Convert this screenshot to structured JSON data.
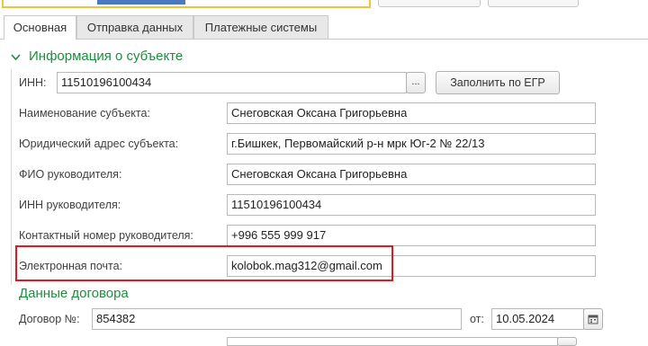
{
  "tabs": [
    "Основная",
    "Отправка данных",
    "Платежные системы"
  ],
  "section_subject": {
    "title": "Информация о субъекте",
    "inn_label": "ИНН:",
    "inn_value": "11510196100434",
    "ellipsis": "...",
    "fill_button": "Заполнить по ЕГР"
  },
  "fields": [
    {
      "label": "Наименование субъекта:",
      "value": "Снеговская Оксана Григорьевна"
    },
    {
      "label": "Юридический адрес субъекта:",
      "value": "г.Бишкек, Первомайский р-н мрк Юг-2 № 22/13"
    },
    {
      "label": "ФИО руководителя:",
      "value": "Снеговская Оксана Григорьевна"
    },
    {
      "label": "ИНН руководителя:",
      "value": "11510196100434"
    },
    {
      "label": "Контактный номер руководителя:",
      "value": "+996 555 999 917"
    },
    {
      "label": "Электронная почта:",
      "value": "kolobok.mag312@gmail.com"
    }
  ],
  "section_contract": {
    "title": "Данные договора",
    "number_label": "Договор №:",
    "number_value": "854382",
    "from_label": "от:",
    "date_value": "10.05.2024"
  },
  "colors": {
    "section_green": "#1a8f3c",
    "highlight_red": "#e3191b",
    "accent_blue": "#4a78c2"
  }
}
